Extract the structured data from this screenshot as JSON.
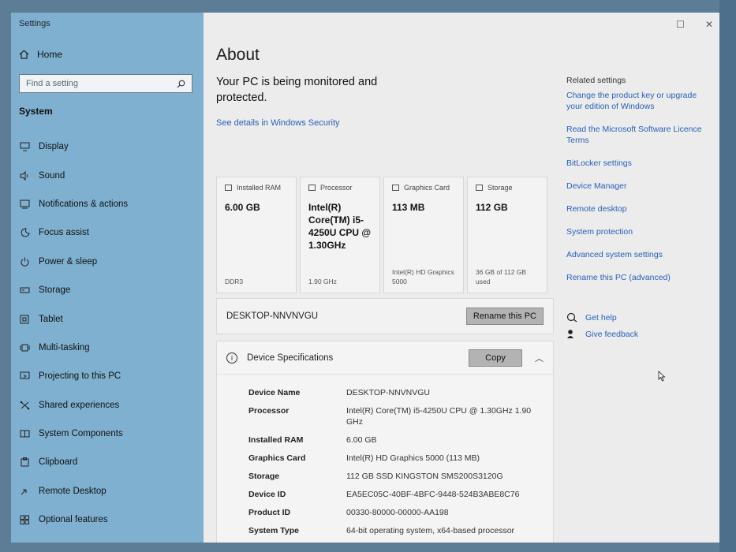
{
  "window": {
    "title": "Settings"
  },
  "sidebar": {
    "home_label": "Home",
    "search_placeholder": "Find a setting",
    "section_label": "System",
    "items": [
      {
        "label": "Display",
        "icon": "display-icon"
      },
      {
        "label": "Sound",
        "icon": "speaker-icon"
      },
      {
        "label": "Notifications & actions",
        "icon": "notification-icon"
      },
      {
        "label": "Focus assist",
        "icon": "moon-icon"
      },
      {
        "label": "Power & sleep",
        "icon": "power-icon"
      },
      {
        "label": "Storage",
        "icon": "storage-icon"
      },
      {
        "label": "Tablet",
        "icon": "tablet-icon"
      },
      {
        "label": "Multi-tasking",
        "icon": "multitasking-icon"
      },
      {
        "label": "Projecting to this PC",
        "icon": "projecting-icon"
      },
      {
        "label": "Shared experiences",
        "icon": "shared-experiences-icon"
      },
      {
        "label": "System Components",
        "icon": "components-icon"
      },
      {
        "label": "Clipboard",
        "icon": "clipboard-icon"
      },
      {
        "label": "Remote Desktop",
        "icon": "remote-desktop-icon"
      },
      {
        "label": "Optional features",
        "icon": "optional-features-icon"
      }
    ]
  },
  "main": {
    "title": "About",
    "monitor_message": "Your PC is being monitored and protected.",
    "security_link": "See details in Windows Security",
    "cards": [
      {
        "label": "Installed RAM",
        "value": "6.00 GB",
        "footer": "DDR3"
      },
      {
        "label": "Processor",
        "value": "Intel(R) Core(TM) i5-4250U CPU @ 1.30GHz",
        "footer": "1.90 GHz"
      },
      {
        "label": "Graphics Card",
        "value": "113 MB",
        "footer": "Intel(R) HD Graphics 5000"
      },
      {
        "label": "Storage",
        "value": "112 GB",
        "footer": "36 GB of 112 GB used"
      }
    ],
    "pc_name": "DESKTOP-NNVNVGU",
    "rename_button": "Rename this PC",
    "spec_title": "Device Specifications",
    "copy_button": "Copy",
    "specs": [
      {
        "key": "Device Name",
        "value": "DESKTOP-NNVNVGU"
      },
      {
        "key": "Processor",
        "value": "Intel(R) Core(TM) i5-4250U CPU @ 1.30GHz 1.90 GHz"
      },
      {
        "key": "Installed RAM",
        "value": "6.00 GB"
      },
      {
        "key": "Graphics Card",
        "value": "Intel(R) HD Graphics 5000 (113 MB)"
      },
      {
        "key": "Storage",
        "value": "112 GB SSD KINGSTON SMS200S3120G"
      },
      {
        "key": "Device ID",
        "value": "EA5EC05C-40BF-4BFC-9448-524B3ABE8C76"
      },
      {
        "key": "Product ID",
        "value": "00330-80000-00000-AA198"
      },
      {
        "key": "System Type",
        "value": "64-bit operating system, x64-based processor"
      }
    ]
  },
  "related": {
    "title": "Related settings",
    "links": [
      "Change the product key or upgrade your edition of Windows",
      "Read the Microsoft Software Licence Terms",
      "BitLocker settings",
      "Device Manager",
      "Remote desktop",
      "System protection",
      "Advanced system settings",
      "Rename this PC (advanced)"
    ],
    "help_label": "Get help",
    "feedback_label": "Give feedback"
  },
  "colors": {
    "sidebar_bg": "#7fb0cf",
    "link": "#2760b8",
    "button": "#b3b3b3"
  }
}
